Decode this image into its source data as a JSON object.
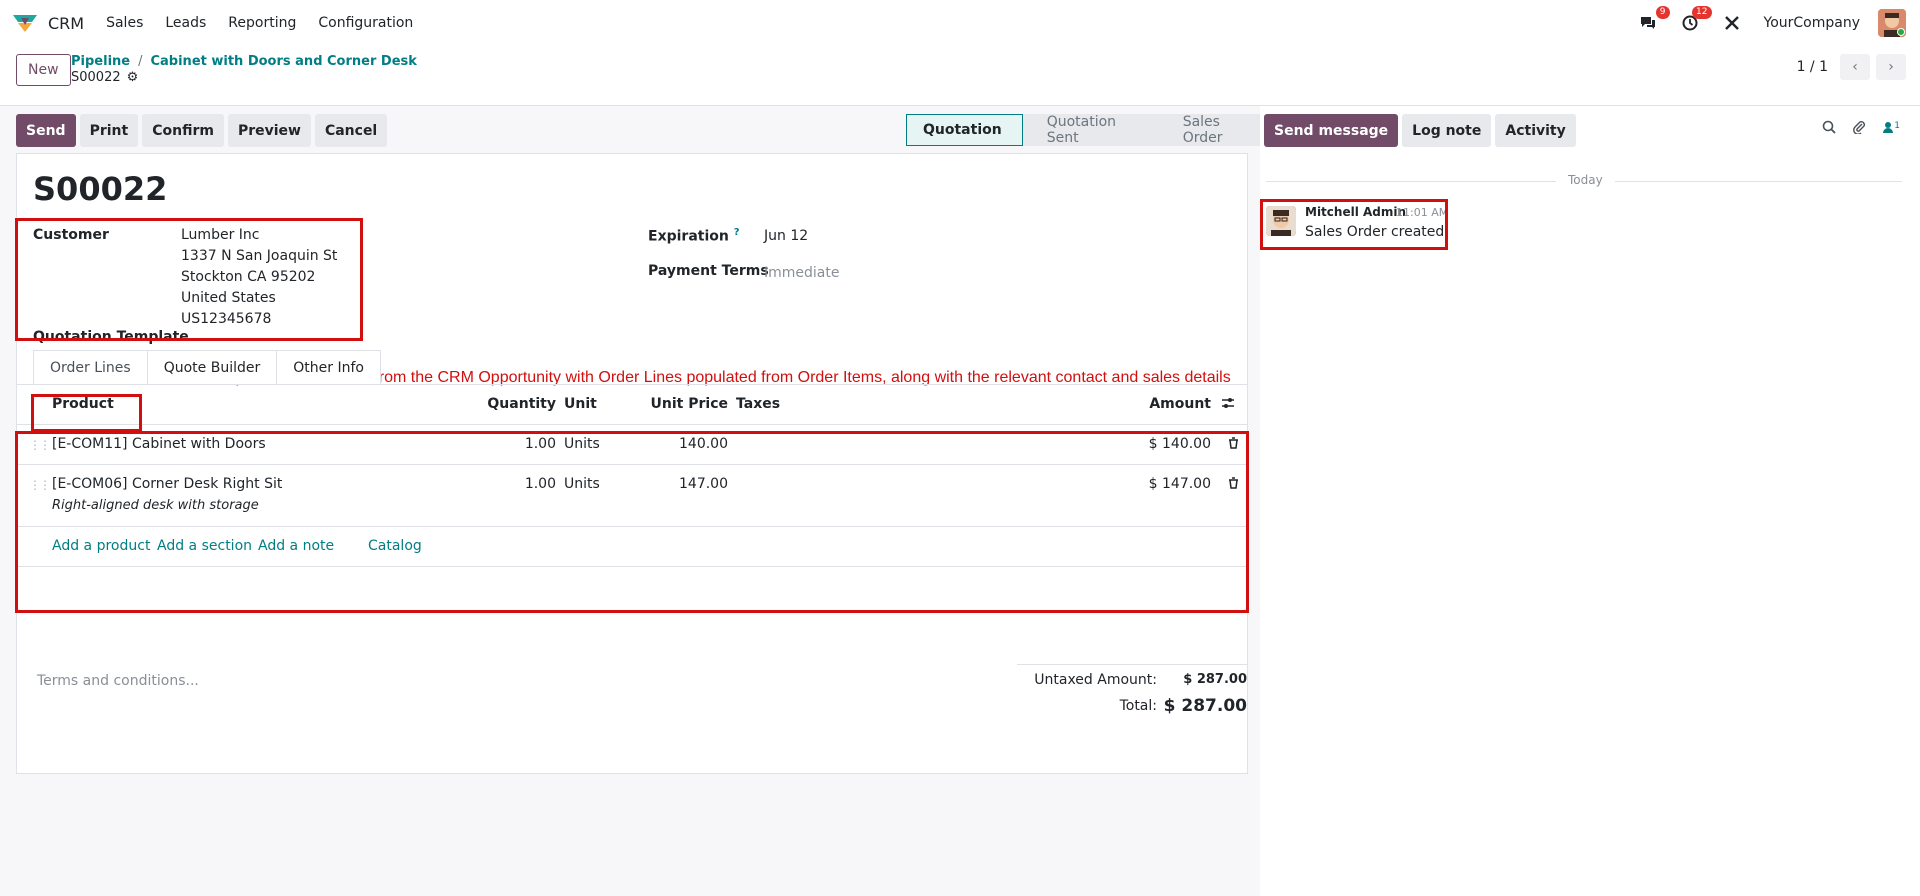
{
  "navbar": {
    "app_name": "CRM",
    "menu": [
      "Sales",
      "Leads",
      "Reporting",
      "Configuration"
    ],
    "messages_badge": "9",
    "activities_badge": "12",
    "company": "YourCompany"
  },
  "control": {
    "new_label": "New",
    "breadcrumb": [
      "Pipeline",
      "Cabinet with Doors and Corner Desk"
    ],
    "record": "S00022",
    "pager": "1 / 1"
  },
  "actions": [
    "Send",
    "Print",
    "Confirm",
    "Preview",
    "Cancel"
  ],
  "status_bar": [
    "Quotation",
    "Quotation Sent",
    "Sales Order"
  ],
  "form": {
    "title": "S00022",
    "customer_label": "Customer",
    "customer_lines": [
      "Lumber Inc",
      "1337 N San Joaquin St",
      "Stockton CA 95202",
      "United States",
      "US12345678"
    ],
    "expiration_label": "Expiration",
    "expiration_help": "?",
    "expiration_value": "Jun 12",
    "payment_terms_label": "Payment Terms",
    "payment_terms_value": "Immediate",
    "quotation_template_label": "Quotation Template",
    "annotation": "A quotation is created from the CRM Opportunity with Order Lines populated from Order Items, along with the relevant contact and sales details"
  },
  "tabs": [
    "Order Lines",
    "Quote Builder",
    "Other Info"
  ],
  "order_table": {
    "headers": {
      "product": "Product",
      "quantity": "Quantity",
      "unit": "Unit",
      "unit_price": "Unit Price",
      "taxes": "Taxes",
      "amount": "Amount"
    },
    "rows": [
      {
        "product": "[E-COM11] Cabinet with Doors",
        "quantity": "1.00",
        "unit": "Units",
        "unit_price": "140.00",
        "amount": "$ 140.00",
        "description": ""
      },
      {
        "product": "[E-COM06] Corner Desk Right Sit",
        "quantity": "1.00",
        "unit": "Units",
        "unit_price": "147.00",
        "amount": "$ 147.00",
        "description": "Right-aligned desk with storage"
      }
    ],
    "links": [
      "Add a product",
      "Add a section",
      "Add a note",
      "Catalog"
    ]
  },
  "footer": {
    "terms_placeholder": "Terms and conditions...",
    "untaxed_label": "Untaxed Amount:",
    "untaxed_value": "$ 287.00",
    "total_label": "Total:",
    "total_value": "$ 287.00"
  },
  "chatter": {
    "buttons": [
      "Send message",
      "Log note",
      "Activity"
    ],
    "followers_count": "1",
    "today": "Today",
    "message": {
      "author": "Mitchell Admin",
      "time": "11:01 AM",
      "body": "Sales Order created"
    }
  },
  "colors": {
    "primary": "#714b67",
    "link": "#017e84",
    "annotation_red": "#d10f0f"
  }
}
